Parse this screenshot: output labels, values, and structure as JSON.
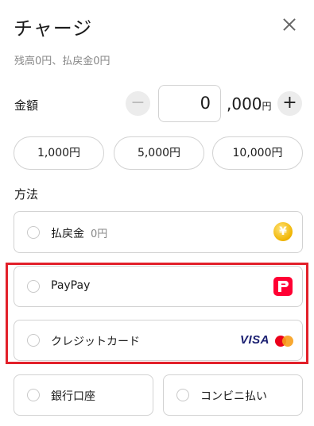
{
  "header": {
    "title": "チャージ",
    "balance_text": "残高0円、払戻金0円"
  },
  "amount": {
    "label": "金額",
    "minus_label": "−",
    "value": "0",
    "suffix": ",000",
    "suffix_unit": "円",
    "plus_label": "+",
    "presets": [
      "1,000円",
      "5,000円",
      "10,000円"
    ]
  },
  "method": {
    "label": "方法",
    "options": [
      {
        "label": "払戻金",
        "sub": "0円",
        "icon": "yen-coin-icon"
      },
      {
        "label": "PayPay",
        "icon": "paypay-icon"
      },
      {
        "label": "クレジットカード",
        "brand": "VISA",
        "icon": "mastercard-icon"
      },
      {
        "label": "銀行口座"
      },
      {
        "label": "コンビニ払い"
      }
    ]
  },
  "colors": {
    "highlight": "#e2202a",
    "paypay": "#ff0033",
    "visa": "#1a1f71",
    "coin": "#f0b400"
  }
}
